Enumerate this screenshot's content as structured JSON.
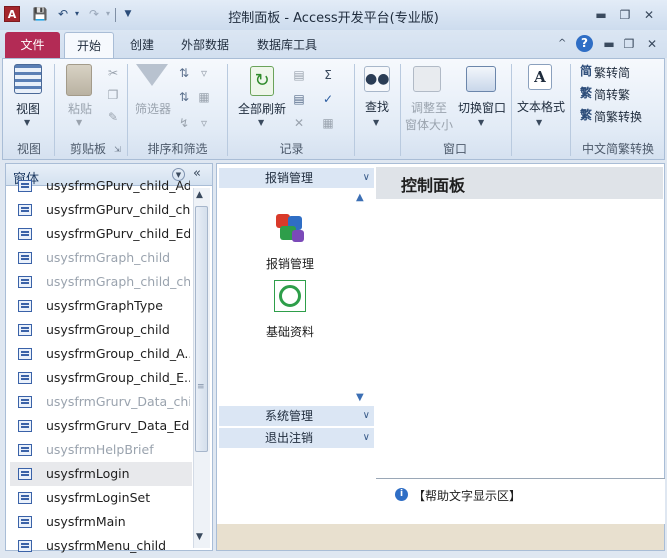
{
  "window": {
    "title": "控制面板 - Access开发平台(专业版)",
    "app_icon": "A",
    "controls": [
      "minimize-icon",
      "restore-icon",
      "close-icon"
    ]
  },
  "tabs": [
    {
      "label": "文件"
    },
    {
      "label": "开始"
    },
    {
      "label": "创建"
    },
    {
      "label": "外部数据"
    },
    {
      "label": "数据库工具"
    }
  ],
  "ribbon": {
    "groups": {
      "views": "视图",
      "clipboard": "剪贴板",
      "sort_filter": "排序和筛选",
      "records": "记录",
      "window": "窗口",
      "conversion": "中文简繁转换"
    },
    "buttons": {
      "view": "视图",
      "paste": "粘贴",
      "filter": "筛选器",
      "refresh_all": "全部刷新",
      "find": "查找",
      "resize_line1": "调整至",
      "resize_line2": "窗体大小",
      "switch_window": "切换窗口",
      "text_format": "文本格式",
      "to_simplified": "繁转简",
      "to_traditional": "简转繁",
      "convert": "简繁转换"
    }
  },
  "nav": {
    "header": "窗体",
    "items": [
      {
        "label": "usysfrmGPurv_child_Add",
        "disabled": false
      },
      {
        "label": "usysfrmGPurv_child_ch...",
        "disabled": false
      },
      {
        "label": "usysfrmGPurv_child_Edit",
        "disabled": false
      },
      {
        "label": "usysfrmGraph_child",
        "disabled": true
      },
      {
        "label": "usysfrmGraph_child_ch...",
        "disabled": true
      },
      {
        "label": "usysfrmGraphType",
        "disabled": false
      },
      {
        "label": "usysfrmGroup_child",
        "disabled": false
      },
      {
        "label": "usysfrmGroup_child_A...",
        "disabled": false
      },
      {
        "label": "usysfrmGroup_child_E...",
        "disabled": false
      },
      {
        "label": "usysfrmGrurv_Data_chi...",
        "disabled": true
      },
      {
        "label": "usysfrmGrurv_Data_Edit",
        "disabled": false
      },
      {
        "label": "usysfrmHelpBrief",
        "disabled": true
      },
      {
        "label": "usysfrmLogin",
        "disabled": false
      },
      {
        "label": "usysfrmLoginSet",
        "disabled": false
      },
      {
        "label": "usysfrmMain",
        "disabled": false
      },
      {
        "label": "usysfrmMenu_child",
        "disabled": false
      }
    ]
  },
  "switchboard": {
    "sections": [
      {
        "label": "报销管理"
      },
      {
        "label": "系统管理"
      },
      {
        "label": "退出注销"
      }
    ],
    "buttons": [
      {
        "label": "报销管理"
      },
      {
        "label": "基础资料"
      }
    ],
    "panel_title": "控制面板",
    "help_text": "【帮助文字显示区】"
  }
}
